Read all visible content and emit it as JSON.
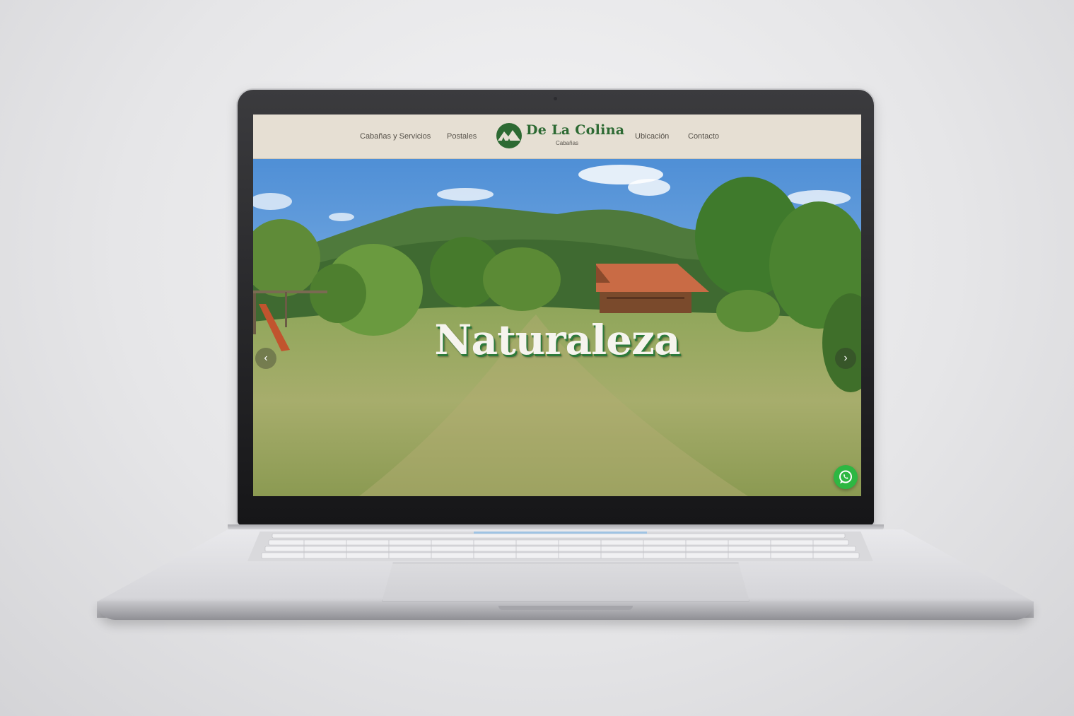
{
  "site": {
    "nav": {
      "left": [
        "Cabañas y Servicios",
        "Postales"
      ],
      "right": [
        "Ubicación",
        "Contacto"
      ]
    },
    "logo": {
      "title": "De La Colina",
      "subtitle": "Cabañas",
      "icon": "mountain-pine-logo-icon"
    },
    "hero": {
      "title": "Naturaleza",
      "prev_icon": "chevron-left-icon",
      "next_icon": "chevron-right-icon",
      "prev_glyph": "‹",
      "next_glyph": "›"
    },
    "whatsapp_icon": "whatsapp-icon"
  },
  "colors": {
    "brand_green": "#2d6a33",
    "header_bg": "#e6dfd3",
    "whatsapp_green": "#2db742"
  }
}
